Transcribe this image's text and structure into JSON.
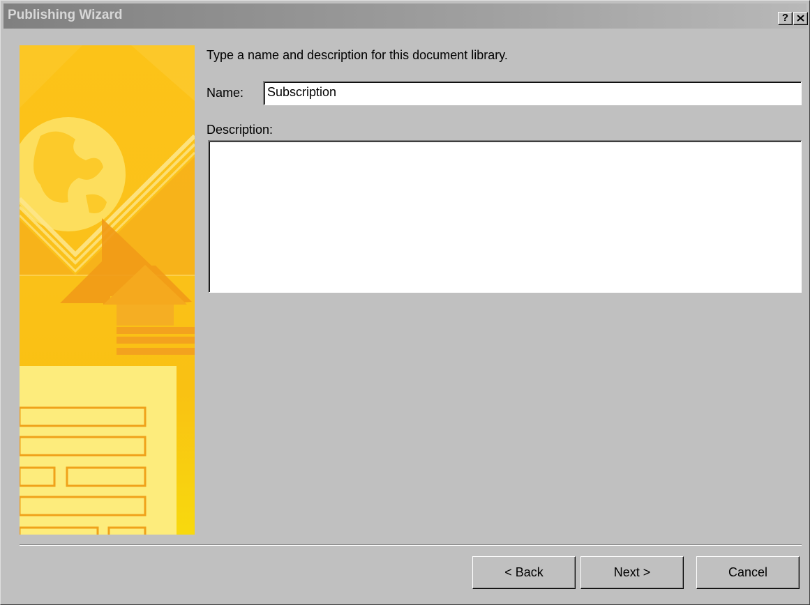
{
  "window": {
    "title": "Publishing Wizard",
    "help_label": "?",
    "close_label": "✕"
  },
  "content": {
    "instruction": "Type a name and description for this document library.",
    "name_label": "Name:",
    "name_value": "Subscription",
    "description_label": "Description:",
    "description_value": ""
  },
  "buttons": {
    "back": "< Back",
    "next": "Next >",
    "cancel": "Cancel"
  },
  "colors": {
    "dialog_bg": "#c0c0c0",
    "titlebar": "#808080",
    "sidebar_accent": "#fcc318"
  },
  "icons": {
    "sidebar_art": "globe-upload-document-illustration"
  }
}
